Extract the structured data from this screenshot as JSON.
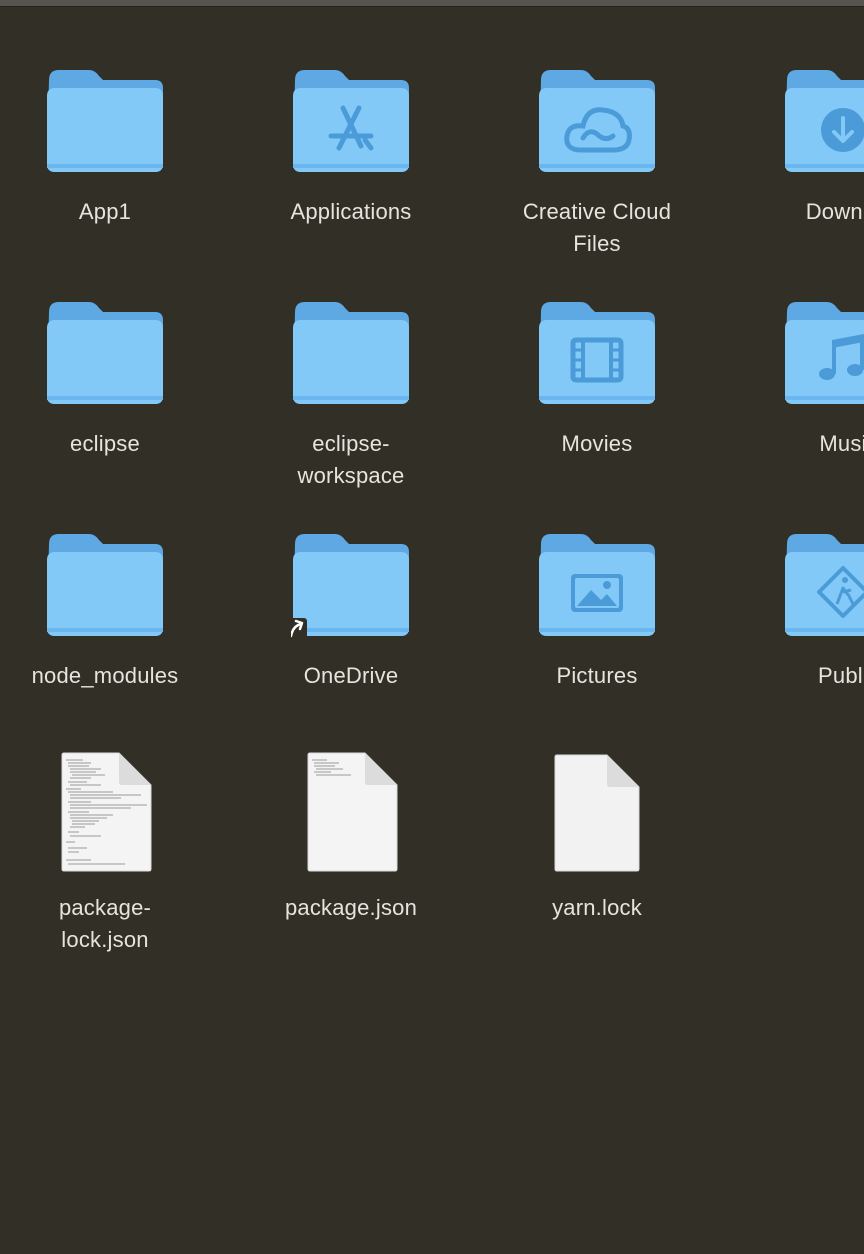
{
  "window": {
    "title": ""
  },
  "items": [
    {
      "name": "App1",
      "kind": "folder",
      "glyph": "none"
    },
    {
      "name": "Applications",
      "kind": "folder",
      "glyph": "applications-icon"
    },
    {
      "name": "Creative Cloud\nFiles",
      "kind": "folder",
      "glyph": "creative-cloud-icon"
    },
    {
      "name": "Downlo",
      "kind": "folder",
      "glyph": "download-icon"
    },
    {
      "name": "eclipse",
      "kind": "folder",
      "glyph": "none"
    },
    {
      "name": "eclipse-\nworkspace",
      "kind": "folder",
      "glyph": "none"
    },
    {
      "name": "Movies",
      "kind": "folder",
      "glyph": "film-icon"
    },
    {
      "name": "Musi",
      "kind": "folder",
      "glyph": "music-note-icon"
    },
    {
      "name": "node_modules",
      "kind": "folder",
      "glyph": "none"
    },
    {
      "name": "OneDrive",
      "kind": "folder",
      "glyph": "alias-arrow-icon"
    },
    {
      "name": "Pictures",
      "kind": "folder",
      "glyph": "picture-icon"
    },
    {
      "name": "Publi",
      "kind": "folder",
      "glyph": "public-icon"
    },
    {
      "name": "package-\nlock.json",
      "kind": "document",
      "glyph": "text-preview"
    },
    {
      "name": "package.json",
      "kind": "document",
      "glyph": "text-preview-short"
    },
    {
      "name": "yarn.lock",
      "kind": "document",
      "glyph": "blank"
    }
  ],
  "colors": {
    "background": "#323026",
    "folder_back": "#5fb0ea",
    "folder_front": "#7dc7f7",
    "folder_glyph": "#4a9ad8",
    "label": "#e6e4dc",
    "document": "#f2f2f2"
  }
}
